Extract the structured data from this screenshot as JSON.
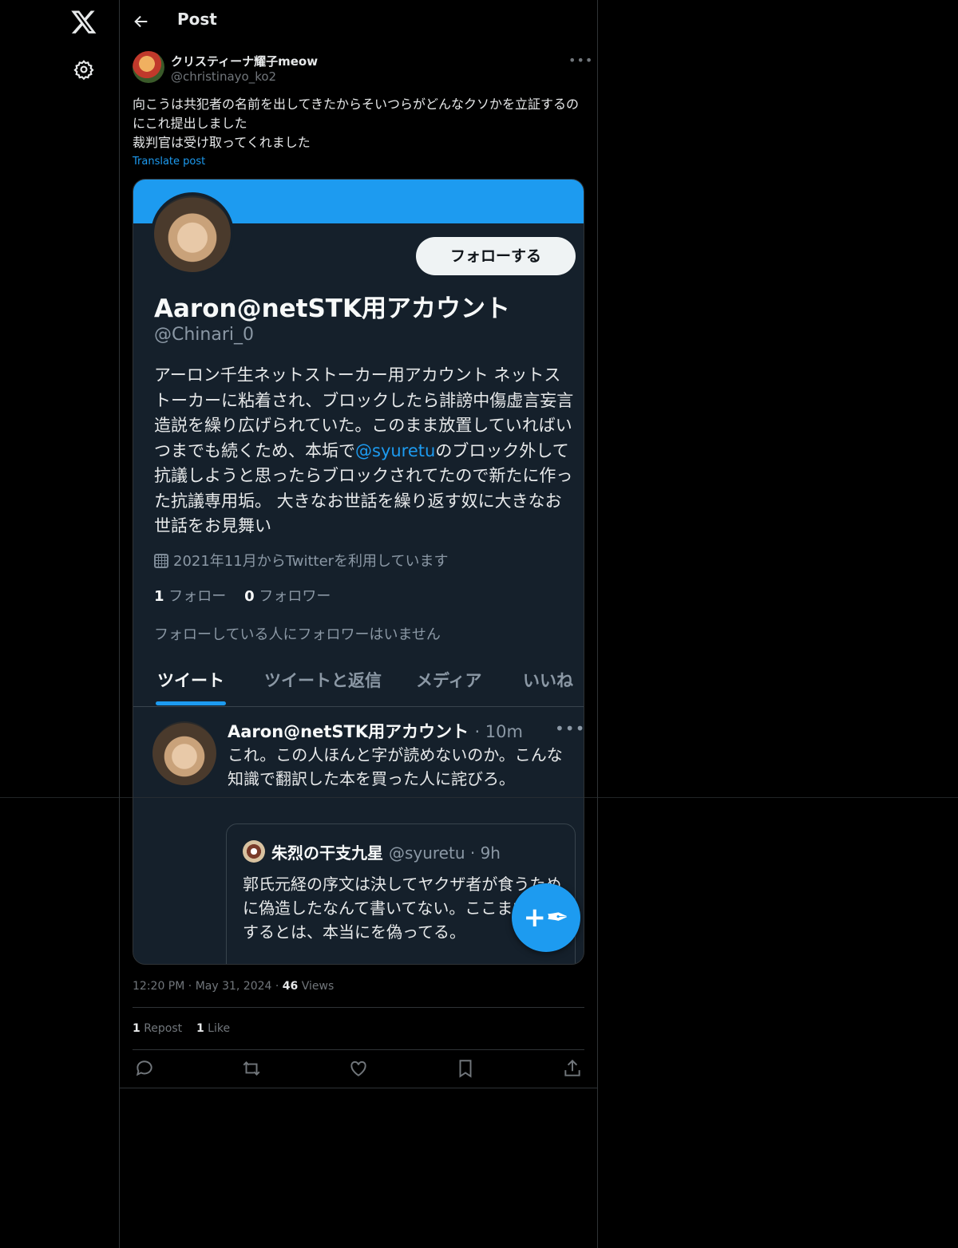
{
  "header": {
    "title": "Post"
  },
  "author": {
    "name": "クリスティーナ耀子meow",
    "handle": "@christinayo_ko2"
  },
  "post": {
    "text": "向こうは共犯者の名前を出してきたからそいつらがどんなクソかを立証するのにこれ提出しました\n裁判官は受け取ってくれました",
    "translate_label": "Translate post"
  },
  "screenshot": {
    "follow_label": "フォローする",
    "name": "Aaron@netSTK用アカウント",
    "handle": "@Chinari_0",
    "bio_before": "アーロン千生ネットストーカー用アカウント ネットストーカーに粘着され、ブロックしたら誹謗中傷虚言妄言造説を繰り広げられていた。このまま放置していればいつまでも続くため、本垢で",
    "bio_mention": "@syuretu",
    "bio_after": "のブロック外して抗議しようと思ったらブロックされてたので新たに作った抗議専用垢。 大きなお世話を繰り返す奴に大きなお世話をお見舞い",
    "joined": "2021年11月からTwitterを利用しています",
    "following_count": "1",
    "following_label": "フォロー",
    "followers_count": "0",
    "followers_label": "フォロワー",
    "no_followers_note": "フォローしている人にフォロワーはいません",
    "tabs": [
      "ツイート",
      "ツイートと返信",
      "メディア",
      "いいね"
    ],
    "tweet": {
      "name": "Aaron@netSTK用アカウント",
      "time": "· 10m",
      "text": "これ。この人ほんと字が読めないのか。こんな知識で翻訳した本を買った人に詫びろ。"
    },
    "quote": {
      "name": "朱烈の干支九星",
      "handle_time": "@syuretu · 9h",
      "text": "郭氏元経の序文は決してヤクザ者が食うために偽造したなんて書いてない。ここまで自作するとは、本当にを偽ってる。"
    },
    "fab_icon": "compose-plus-icon"
  },
  "meta": {
    "time": "12:20 PM",
    "date": "May 31, 2024",
    "views_count": "46",
    "views_label": "Views"
  },
  "engagement": {
    "reposts_count": "1",
    "reposts_label": "Repost",
    "likes_count": "1",
    "likes_label": "Like"
  },
  "colors": {
    "accent": "#1d9bf0",
    "background": "#000000",
    "card": "#15202b"
  }
}
